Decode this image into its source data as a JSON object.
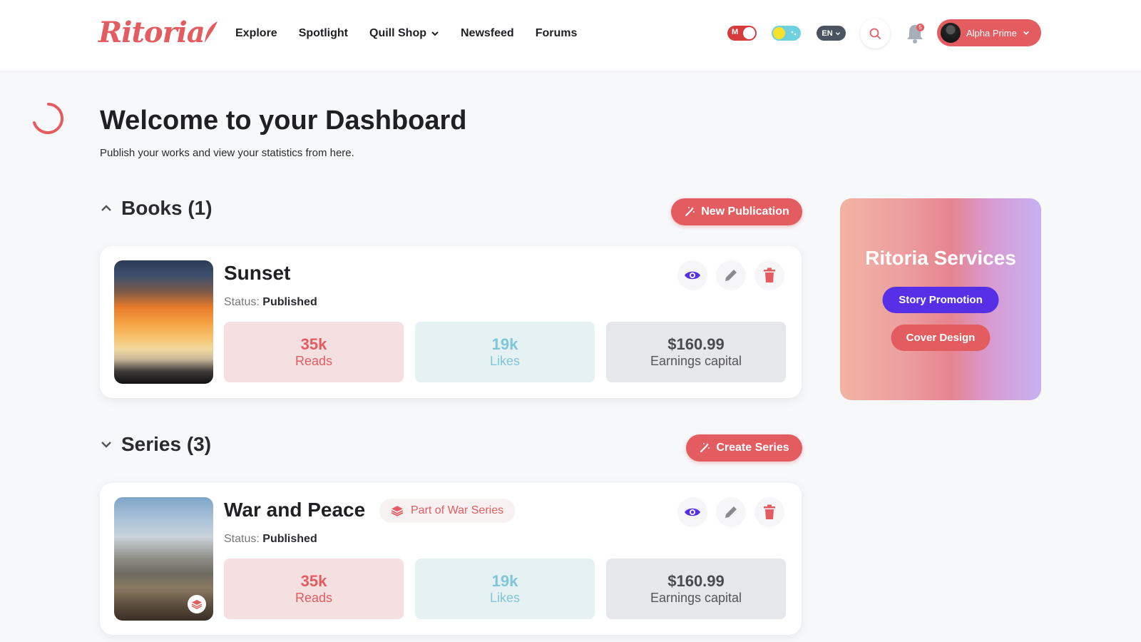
{
  "header": {
    "logo": "Ritoria",
    "nav": [
      "Explore",
      "Spotlight",
      "Quill Shop",
      "Newsfeed",
      "Forums"
    ],
    "toggle_mode_label": "M",
    "language": "EN",
    "notifications_count": "5",
    "user_name": "Alpha Prime"
  },
  "page": {
    "title": "Welcome to your Dashboard",
    "subtitle": "Publish your works and view your statistics from here."
  },
  "books": {
    "heading": "Books (1)",
    "button": "New Publication",
    "items": [
      {
        "title": "Sunset",
        "status_label": "Status:",
        "status": "Published",
        "reads_value": "35k",
        "reads_label": "Reads",
        "likes_value": "19k",
        "likes_label": "Likes",
        "earnings_value": "$160.99",
        "earnings_label": "Earnings capital"
      }
    ]
  },
  "series": {
    "heading": "Series (3)",
    "button": "Create Series",
    "items": [
      {
        "title": "War and Peace",
        "tag": "Part of War Series",
        "status_label": "Status:",
        "status": "Published",
        "reads_value": "35k",
        "reads_label": "Reads",
        "likes_value": "19k",
        "likes_label": "Likes",
        "earnings_value": "$160.99",
        "earnings_label": "Earnings capital"
      }
    ]
  },
  "services": {
    "title": "Ritoria Services",
    "buttons": [
      "Story Promotion",
      "Cover Design"
    ]
  },
  "colors": {
    "accent": "#e25c60",
    "purple": "#5530e6",
    "likes": "#7ec6d8"
  }
}
